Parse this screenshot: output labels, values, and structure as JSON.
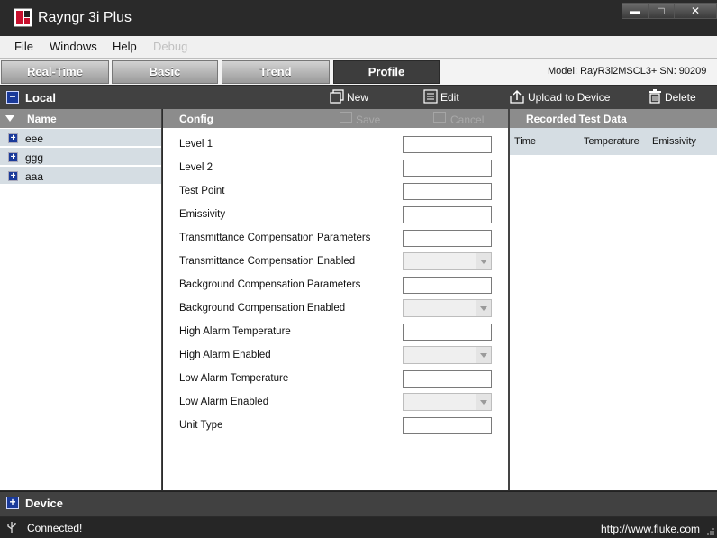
{
  "window": {
    "title": "Rayngr 3i Plus",
    "minimize": "▬",
    "maximize": "□",
    "close": "✕"
  },
  "menu": {
    "items": [
      "File",
      "Windows",
      "Help",
      "Debug"
    ]
  },
  "tabs": {
    "items": [
      "Real-Time",
      "Basic",
      "Trend",
      "Profile"
    ],
    "active": "Profile"
  },
  "model_info": "Model: RayR3i2MSCL3+  SN: 90209",
  "toolbar": {
    "section": "Local",
    "new": "New",
    "edit": "Edit",
    "upload": "Upload to Device",
    "delete": "Delete"
  },
  "left_panel": {
    "header": "Name",
    "items": [
      "eee",
      "ggg",
      "aaa"
    ]
  },
  "config": {
    "header": "Config",
    "save": "Save",
    "cancel": "Cancel",
    "fields": [
      {
        "label": "Level 1",
        "type": "text",
        "value": ""
      },
      {
        "label": "Level 2",
        "type": "text",
        "value": ""
      },
      {
        "label": "Test Point",
        "type": "text",
        "value": ""
      },
      {
        "label": "Emissivity",
        "type": "text",
        "value": ""
      },
      {
        "label": "Transmittance Compensation Parameters",
        "type": "text",
        "value": ""
      },
      {
        "label": "Transmittance Compensation Enabled",
        "type": "select",
        "value": ""
      },
      {
        "label": "Background Compensation Parameters",
        "type": "text",
        "value": ""
      },
      {
        "label": "Background Compensation Enabled",
        "type": "select",
        "value": ""
      },
      {
        "label": "High Alarm Temperature",
        "type": "text",
        "value": ""
      },
      {
        "label": "High Alarm Enabled",
        "type": "select",
        "value": ""
      },
      {
        "label": "Low Alarm Temperature",
        "type": "text",
        "value": ""
      },
      {
        "label": "Low Alarm Enabled",
        "type": "select",
        "value": ""
      },
      {
        "label": "Unit Type",
        "type": "text",
        "value": ""
      }
    ]
  },
  "recorded": {
    "header": "Recorded Test Data",
    "columns": [
      "Time",
      "Temperature",
      "Emissivity"
    ]
  },
  "device": {
    "label": "Device"
  },
  "status": {
    "text": "Connected!",
    "url": "http://www.fluke.com"
  }
}
